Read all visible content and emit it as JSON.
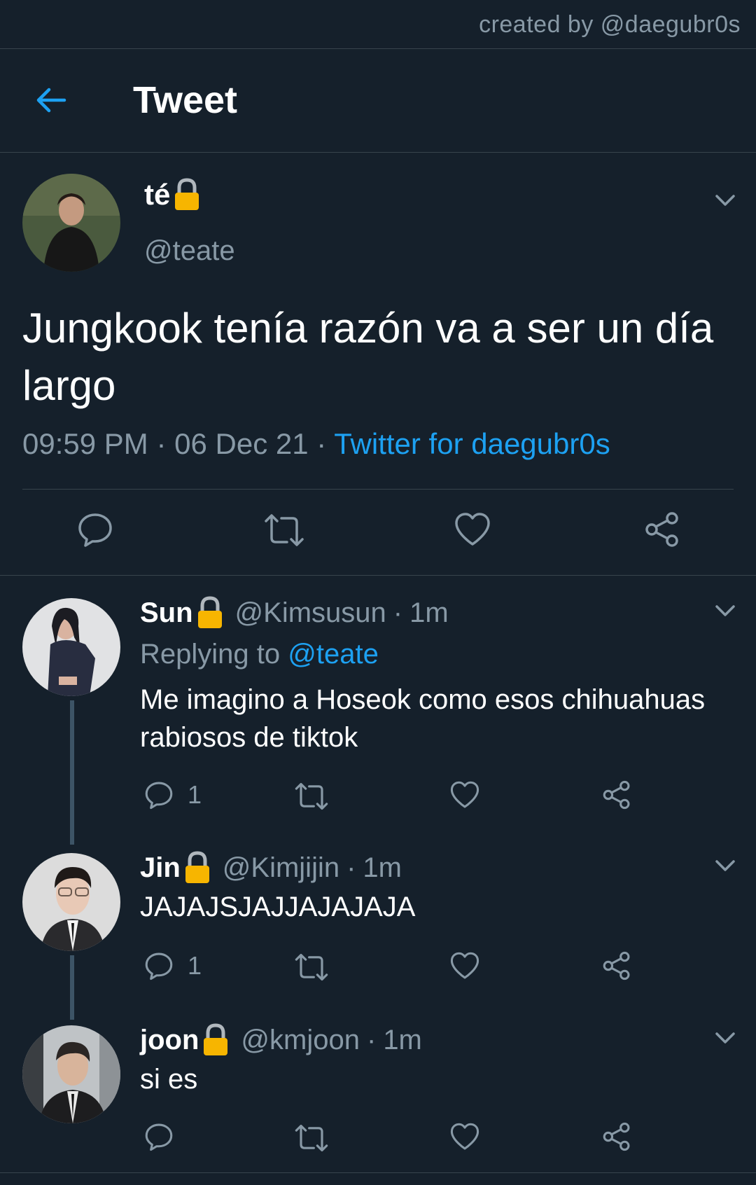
{
  "credit": "created by @daegubr0s",
  "header": {
    "title": "Tweet"
  },
  "main_tweet": {
    "display_name": "té",
    "handle": "@teate",
    "text": "Jungkook tenía razón va a ser un día largo",
    "time": "09:59 PM",
    "date": "06 Dec 21",
    "source": "Twitter for daegubr0s",
    "meta_sep": "·"
  },
  "replies": [
    {
      "display_name": "Sun",
      "handle": "@Kimsusun",
      "time": "1m",
      "replying_label": "Replying to",
      "replying_to": "@teate",
      "text": "Me imagino a Hoseok como esos chihuahuas rabiosos de tiktok",
      "reply_count": "1"
    },
    {
      "display_name": "Jin",
      "handle": "@Kimjijin",
      "time": "1m",
      "text": "JAJAJSJAJJAJAJAJA",
      "reply_count": "1"
    },
    {
      "display_name": "joon",
      "handle": "@kmjoon",
      "time": "1m",
      "text": "si es",
      "reply_count": ""
    }
  ],
  "sep": "·",
  "colors": {
    "background": "#15202b",
    "accent": "#1da1f2",
    "muted": "#8899a6",
    "divider": "#38444d",
    "lock": "#f7b500"
  },
  "icons": [
    "back-arrow-icon",
    "lock-icon",
    "chevron-down-icon",
    "reply-icon",
    "retweet-icon",
    "like-icon",
    "share-icon"
  ]
}
